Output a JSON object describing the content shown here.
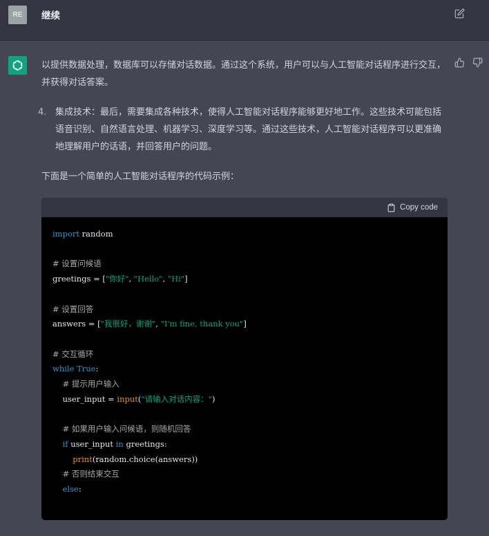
{
  "user": {
    "avatar_text": "RE",
    "message": "继续"
  },
  "assistant": {
    "paragraph1": "以提供数据处理，数据库可以存储对话数据。通过这个系统，用户可以与人工智能对话程序进行交互，并获得对话答案。",
    "list_item": {
      "number": "4.",
      "text": "集成技术：最后，需要集成各种技术，使得人工智能对话程序能够更好地工作。这些技术可能包括语音识别、自然语言处理、机器学习、深度学习等。通过这些技术，人工智能对话程序可以更准确地理解用户的话语，并回答用户的问题。"
    },
    "intro": "下面是一个简单的人工智能对话程序的代码示例："
  },
  "code_block": {
    "copy_label": "Copy code",
    "lines": {
      "l1_kw": "import",
      "l1_rest": " random",
      "l3": "# 设置问候语",
      "l4_a": "greetings = [",
      "l4_s1": "\"你好\"",
      "l4_sep1": ", ",
      "l4_s2": "\"Hello\"",
      "l4_sep2": ", ",
      "l4_s3": "\"Hi\"",
      "l4_b": "]",
      "l6": "# 设置回答",
      "l7_a": "answers = [",
      "l7_s1": "\"我很好，谢谢\"",
      "l7_sep": ", ",
      "l7_s2": "\"I'm fine, thank you\"",
      "l7_b": "]",
      "l9": "# 交互循环",
      "l10_kw": "while",
      "l10_sp": " ",
      "l10_true": "True",
      "l10_end": ":",
      "l11": "# 提示用户输入",
      "l12_a": "user_input = ",
      "l12_fn": "input",
      "l12_p1": "(",
      "l12_s": "\"请输入对话内容：\"",
      "l12_p2": ")",
      "l14": "# 如果用户输入问候语，则随机回答",
      "l15_kw": "if",
      "l15_a": " user_input ",
      "l15_in": "in",
      "l15_b": " greetings:",
      "l16_fn": "print",
      "l16_rest": "(random.choice(answers))",
      "l17": "# 否则结束交互",
      "l18_kw": "else",
      "l18_end": ":"
    }
  },
  "icons": {
    "edit": "edit-icon",
    "thumbs_up": "thumbs-up-icon",
    "thumbs_down": "thumbs-down-icon",
    "clipboard": "clipboard-icon",
    "logo": "chatgpt-logo-icon"
  },
  "colors": {
    "user_bg": "#343541",
    "assistant_bg": "#444654",
    "logo_bg": "#10a37f",
    "code_bg": "#000000"
  }
}
